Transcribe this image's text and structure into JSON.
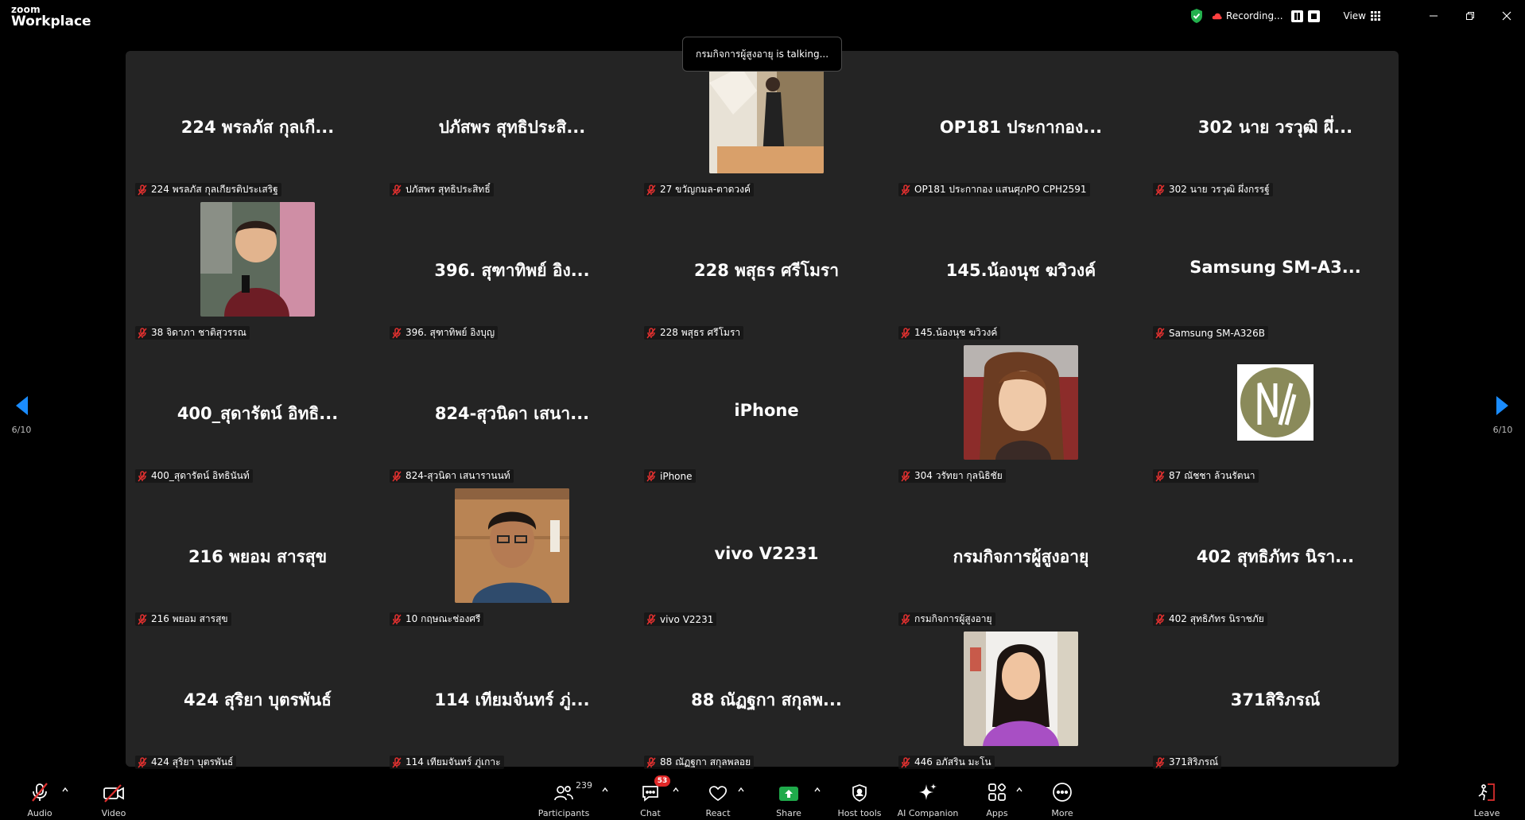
{
  "app": {
    "logo_line1": "zoom",
    "logo_line2": "Workplace"
  },
  "topbar": {
    "recording_label": "Recording...",
    "view_label": "View"
  },
  "speaker_toast": "กรมกิจการผู้สูงอายุ is talking...",
  "pagination": {
    "left": "6/10",
    "right": "6/10"
  },
  "tiles": [
    {
      "display": "224 พรลภัส กุลเกี...",
      "label": "224 พรลภัส กุลเกียรติประเสริฐ",
      "photo": ""
    },
    {
      "display": "ปภัสพร สุทธิประสิ...",
      "label": "ปภัสพร สุทธิประสิทธิ์",
      "photo": ""
    },
    {
      "display": "",
      "label": "27 ขวัญกมล-ตาดวงค์",
      "photo": "temple"
    },
    {
      "display": "OP181 ประกากอง...",
      "label": "OP181 ประกากอง  แสนศุภPO CPH2591",
      "photo": ""
    },
    {
      "display": "302 นาย วรวุฒิ ผึ่...",
      "label": "302 นาย วรวุฒิ ผึ่งกรรฐ์",
      "photo": ""
    },
    {
      "display": "",
      "label": "38 จิดาภา  ชาติสุวรรณ",
      "photo": "woman-red"
    },
    {
      "display": "396. สุฑาทิพย์ อิง...",
      "label": "396. สุฑาทิพย์ อิงบุญ",
      "photo": ""
    },
    {
      "display": "228 พสุธร ศรีโมรา",
      "label": "228 พสุธร ศรีโมรา",
      "photo": ""
    },
    {
      "display": "145.น้องนุช  ฆวิวงค์",
      "label": "145.น้องนุช  ฆวิวงค์",
      "photo": ""
    },
    {
      "display": "Samsung  SM-A3...",
      "label": "Samsung SM-A326B",
      "photo": ""
    },
    {
      "display": "400_สุดารัตน์ อิทธิ...",
      "label": "400_สุดารัตน์ อิทธินันท์",
      "photo": ""
    },
    {
      "display": "824-สุวนิดา เสนา...",
      "label": "824-สุวนิดา เสนารานนท์",
      "photo": ""
    },
    {
      "display": "iPhone",
      "label": "iPhone",
      "photo": ""
    },
    {
      "display": "",
      "label": "304 วรัทยา กุลนิธิชัย",
      "photo": "woman-brown"
    },
    {
      "display": "",
      "label": "87 ณัชชา ล้วนรัตนา",
      "photo": "logo-nn"
    },
    {
      "display": "216 พยอม สารสุข",
      "label": "216 พยอม สารสุข",
      "photo": ""
    },
    {
      "display": "",
      "label": "10 กฤษณะช่องศรี",
      "photo": "man"
    },
    {
      "display": "vivo V2231",
      "label": "vivo V2231",
      "photo": ""
    },
    {
      "display": "กรมกิจการผู้สูงอายุ",
      "label": "กรมกิจการผู้สูงอายุ",
      "photo": ""
    },
    {
      "display": "402 สุทธิภัทร นิรา...",
      "label": "402 สุทธิภัทร นิราชภัย",
      "photo": ""
    },
    {
      "display": "424 สุริยา บุตรพันธ์",
      "label": "424 สุริยา บุตรพันธ์",
      "photo": ""
    },
    {
      "display": "114 เทียมจันทร์ ภู่...",
      "label": "114 เทียมจันทร์ ภู่เกาะ",
      "photo": ""
    },
    {
      "display": "88 ณัฏฐกา สกุลพ...",
      "label": "88 ณัฏฐกา สกุลพลอย",
      "photo": ""
    },
    {
      "display": "",
      "label": "446 อภัสริน มะโน",
      "photo": "woman-purple"
    },
    {
      "display": "371สิริภรณ์",
      "label": "371สิริภรณ์",
      "photo": ""
    }
  ],
  "toolbar": {
    "audio": "Audio",
    "video": "Video",
    "participants": "Participants",
    "participants_count": "239",
    "chat": "Chat",
    "chat_badge": "53",
    "react": "React",
    "share": "Share",
    "host_tools": "Host tools",
    "ai_companion": "AI Companion",
    "apps": "Apps",
    "more": "More",
    "leave": "Leave"
  },
  "colors": {
    "gallery_bg": "#242424",
    "accent_blue": "#1a8cff",
    "share_green": "#1faa4b",
    "muted_red": "#e0302f"
  }
}
